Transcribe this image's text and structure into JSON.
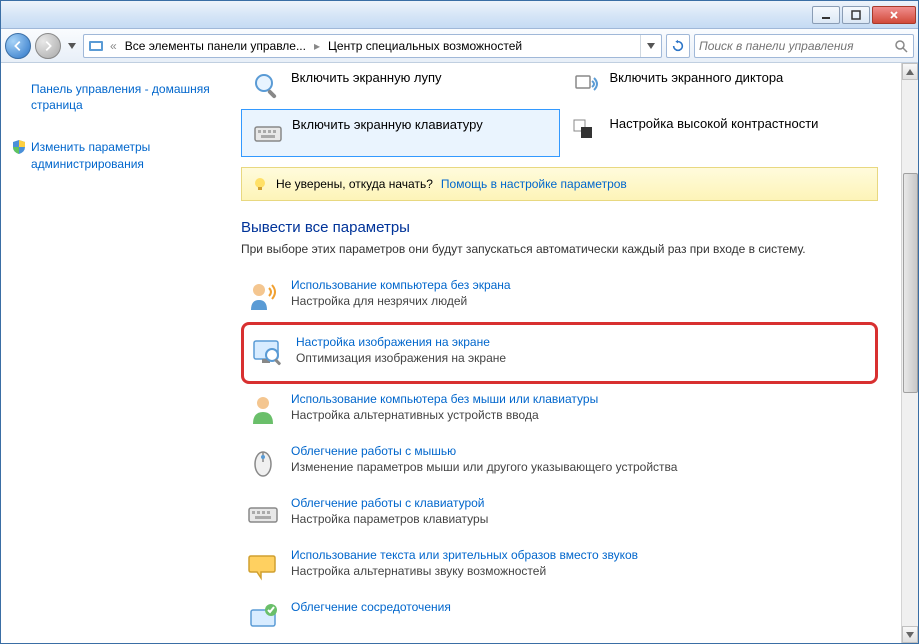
{
  "breadcrumb": {
    "parts": [
      "Все элементы панели управле...",
      "Центр специальных возможностей"
    ]
  },
  "search": {
    "placeholder": "Поиск в панели управления"
  },
  "sidebar": {
    "home": "Панель управления - домашняя страница",
    "admin": "Изменить параметры администрирования"
  },
  "quick": {
    "magnifier": "Включить экранную лупу",
    "narrator": "Включить экранного диктора",
    "keyboard": "Включить экранную клавиатуру",
    "contrast": "Настройка высокой контрастности"
  },
  "help": {
    "prefix": "Не уверены, откуда начать?",
    "link": "Помощь в настройке параметров"
  },
  "section": {
    "title": "Вывести все параметры",
    "desc": "При выборе этих параметров они будут запускаться автоматически каждый раз при входе в систему."
  },
  "items": [
    {
      "link": "Использование компьютера без экрана",
      "desc": "Настройка для незрячих людей"
    },
    {
      "link": "Настройка изображения на экране",
      "desc": "Оптимизация изображения на экране"
    },
    {
      "link": "Использование компьютера без мыши или клавиатуры",
      "desc": "Настройка альтернативных устройств ввода"
    },
    {
      "link": "Облегчение работы с мышью",
      "desc": "Изменение параметров мыши или другого указывающего устройства"
    },
    {
      "link": "Облегчение работы с клавиатурой",
      "desc": "Настройка параметров клавиатуры"
    },
    {
      "link": "Использование текста или зрительных образов вместо звуков",
      "desc": "Настройка альтернативы звуку возможностей"
    },
    {
      "link": "Облегчение сосредоточения",
      "desc": ""
    }
  ]
}
